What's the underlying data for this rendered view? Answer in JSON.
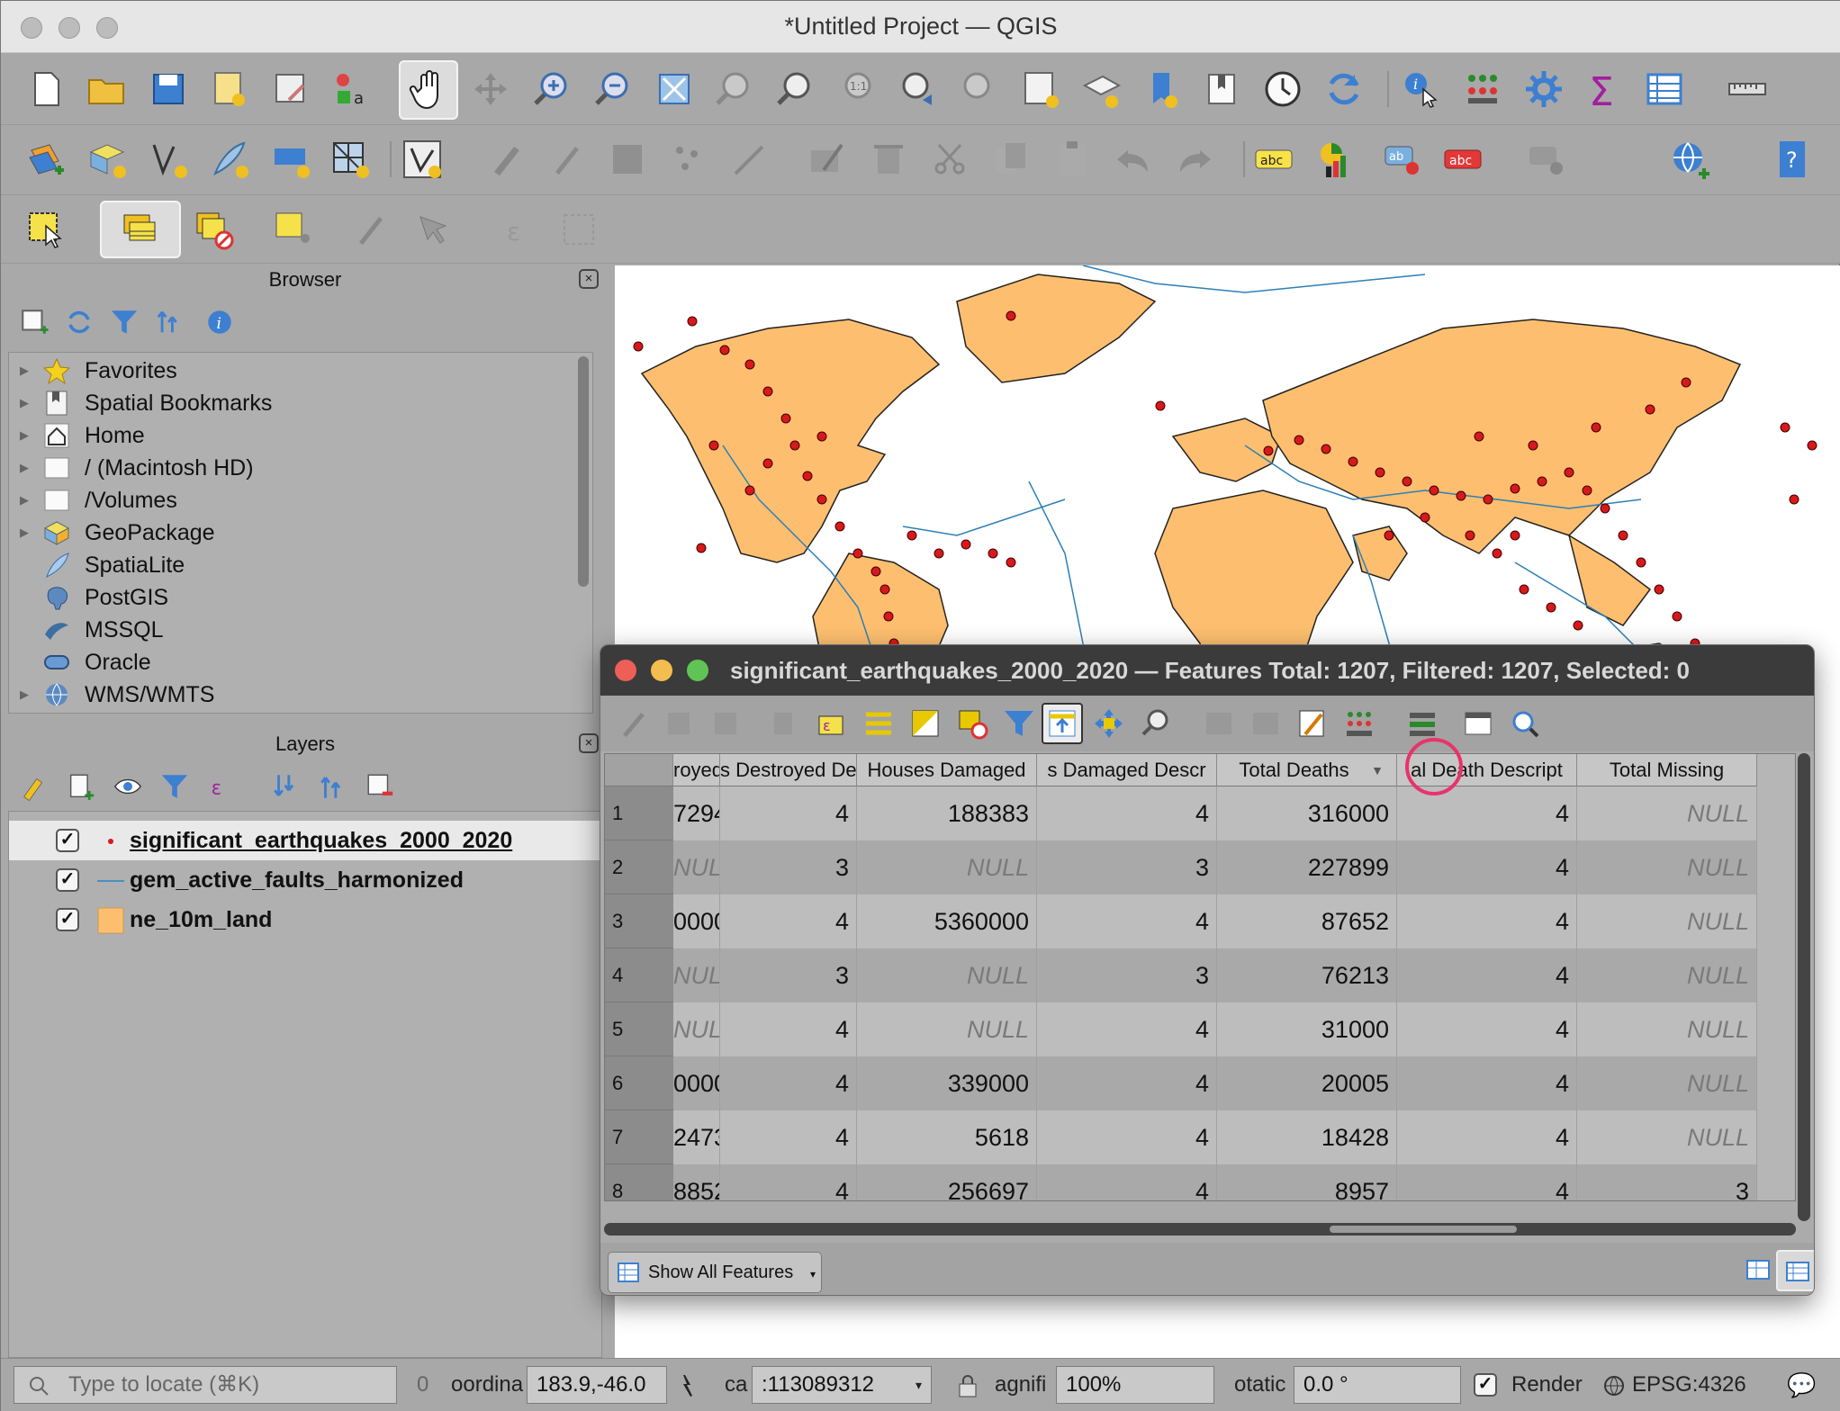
{
  "window": {
    "title": "*Untitled Project — QGIS"
  },
  "browser": {
    "title": "Browser",
    "items": [
      {
        "label": "Favorites",
        "icon": "star-icon"
      },
      {
        "label": "Spatial Bookmarks",
        "icon": "bookmark-icon"
      },
      {
        "label": "Home",
        "icon": "home-icon"
      },
      {
        "label": "/ (Macintosh HD)",
        "icon": "folder-icon"
      },
      {
        "label": "/Volumes",
        "icon": "folder-icon"
      },
      {
        "label": "GeoPackage",
        "icon": "geopackage-icon"
      },
      {
        "label": "SpatiaLite",
        "icon": "spatialite-icon"
      },
      {
        "label": "PostGIS",
        "icon": "postgis-icon"
      },
      {
        "label": "MSSQL",
        "icon": "mssql-icon"
      },
      {
        "label": "Oracle",
        "icon": "oracle-icon"
      },
      {
        "label": "WMS/WMTS",
        "icon": "globe-icon"
      }
    ]
  },
  "layers": {
    "title": "Layers",
    "items": [
      {
        "label": "significant_earthquakes_2000_2020",
        "checked": true,
        "symbol": "point",
        "color": "#d7191c"
      },
      {
        "label": "gem_active_faults_harmonized",
        "checked": true,
        "symbol": "line",
        "color": "#4a90c2"
      },
      {
        "label": "ne_10m_land",
        "checked": true,
        "symbol": "polygon",
        "color": "#fdbf6f"
      }
    ]
  },
  "attribute_table": {
    "title": "significant_earthquakes_2000_2020 — Features Total: 1207, Filtered: 1207, Selected: 0",
    "columns": [
      "royed",
      "s Destroyed Desc",
      "Houses Damaged",
      "s Damaged Descr",
      "Total Deaths",
      "al Death Descript",
      "Total Missing"
    ],
    "sort_indicator": "▼",
    "rows": [
      {
        "n": "1",
        "cells": [
          "7294",
          "4",
          "188383",
          "4",
          "316000",
          "4",
          "NULL"
        ]
      },
      {
        "n": "2",
        "cells": [
          "NULL",
          "3",
          "NULL",
          "3",
          "227899",
          "4",
          "NULL"
        ]
      },
      {
        "n": "3",
        "cells": [
          "0000",
          "4",
          "5360000",
          "4",
          "87652",
          "4",
          "NULL"
        ]
      },
      {
        "n": "4",
        "cells": [
          "NULL",
          "3",
          "NULL",
          "3",
          "76213",
          "4",
          "NULL"
        ]
      },
      {
        "n": "5",
        "cells": [
          "NULL",
          "4",
          "NULL",
          "4",
          "31000",
          "4",
          "NULL"
        ]
      },
      {
        "n": "6",
        "cells": [
          "0000",
          "4",
          "339000",
          "4",
          "20005",
          "4",
          "NULL"
        ]
      },
      {
        "n": "7",
        "cells": [
          "2473",
          "4",
          "5618",
          "4",
          "18428",
          "4",
          "NULL"
        ]
      },
      {
        "n": "8",
        "cells": [
          "8852",
          "4",
          "256697",
          "4",
          "8957",
          "4",
          "3"
        ]
      }
    ],
    "show_all_features": "Show All Features"
  },
  "status": {
    "locate_placeholder": "Type to locate (⌘K)",
    "count": "0",
    "coord_label": "oordina",
    "coord_value": "183.9,-46.0",
    "scale_label": "ca",
    "scale_value": ":113089312",
    "magnifier_label": "agnifi",
    "magnifier_value": "100%",
    "rotation_label": "otatic",
    "rotation_value": "0.0 °",
    "render_label": "Render",
    "crs": "EPSG:4326"
  },
  "colors": {
    "land": "#fdbf6f",
    "quake": "#d7191c",
    "fault": "#2c7fb8",
    "highlight": "#e8336a"
  }
}
